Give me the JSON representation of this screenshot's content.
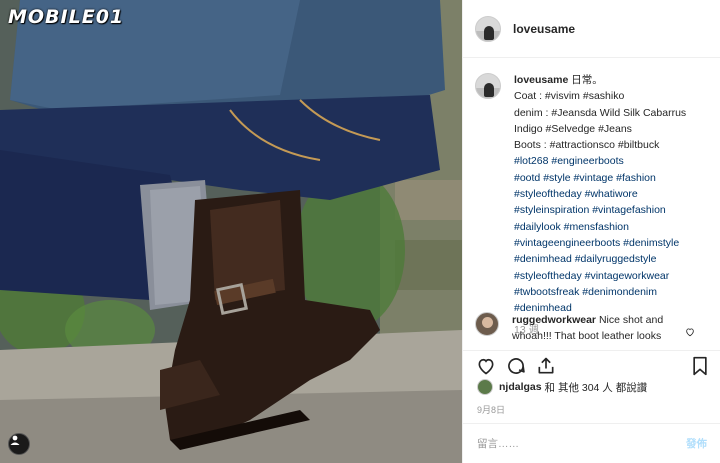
{
  "brand": {
    "watermark": "MOBILE01"
  },
  "post": {
    "username": "loveusame",
    "caption": {
      "username": "loveusame",
      "lines": [
        "日常。",
        "Coat : #visvim #sashiko",
        "denim : #Jeansda Wild Silk Cabarrus",
        "Indigo #Selvedge #Jeans",
        "Boots : #attractionsco #biltbuck",
        "#lot268 #engineerboots",
        "#ootd #style #vintage #fashion",
        "#styleoftheday #whatiwore",
        "#styleinspiration #vintagefashion",
        "#dailylook #mensfashion",
        "#vintageengineerboots #denimstyle",
        "#denimhead #dailyruggedstyle",
        "#styleoftheday #vintageworkwear",
        "#twbootsfreak #denimondenim",
        "#denimhead"
      ],
      "time": "13 週"
    },
    "comment": {
      "username": "ruggedworkwear",
      "text": "Nice shot and whoah!!! That boot leather looks"
    },
    "likes": {
      "username": "njdalgas",
      "text": "和 其他 304 人 都說讚"
    },
    "date": "9月8日",
    "comment_input": {
      "placeholder": "留言……"
    },
    "post_button": "發佈"
  },
  "icons": [
    "heart-icon",
    "comment-icon",
    "share-icon",
    "bookmark-icon",
    "user-tag-icon"
  ],
  "colors": {
    "hashtag": "#003569",
    "muted": "#999999",
    "post_button": "#b2dffc"
  }
}
